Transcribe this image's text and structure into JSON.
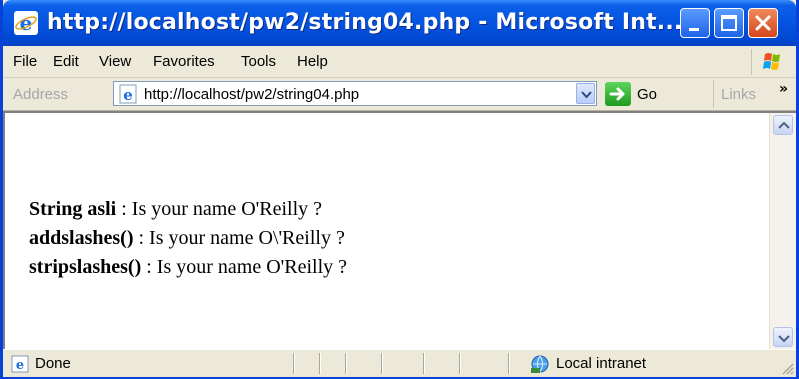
{
  "window": {
    "title": "http://localhost/pw2/string04.php - Microsoft Int..."
  },
  "menu": {
    "items": [
      {
        "label": "File"
      },
      {
        "label": "Edit"
      },
      {
        "label": "View"
      },
      {
        "label": "Favorites"
      },
      {
        "label": "Tools"
      },
      {
        "label": "Help"
      }
    ]
  },
  "address": {
    "label": "Address",
    "url": "http://localhost/pw2/string04.php",
    "go_label": "Go",
    "links_label": "Links",
    "links_chevron": "»"
  },
  "content": {
    "lines": [
      {
        "bold": "String asli",
        "rest": " : Is your name O'Reilly ?"
      },
      {
        "bold": "addslashes()",
        "rest": " : Is your name O\\'Reilly ?"
      },
      {
        "bold": "stripslashes()",
        "rest": " : Is your name O'Reilly ?"
      }
    ]
  },
  "status": {
    "text": "Done",
    "zone": "Local intranet"
  },
  "icons": {
    "title": "ie-icon",
    "address": "ie-page-icon",
    "status": "ie-page-icon",
    "zone": "local-intranet-icon"
  }
}
